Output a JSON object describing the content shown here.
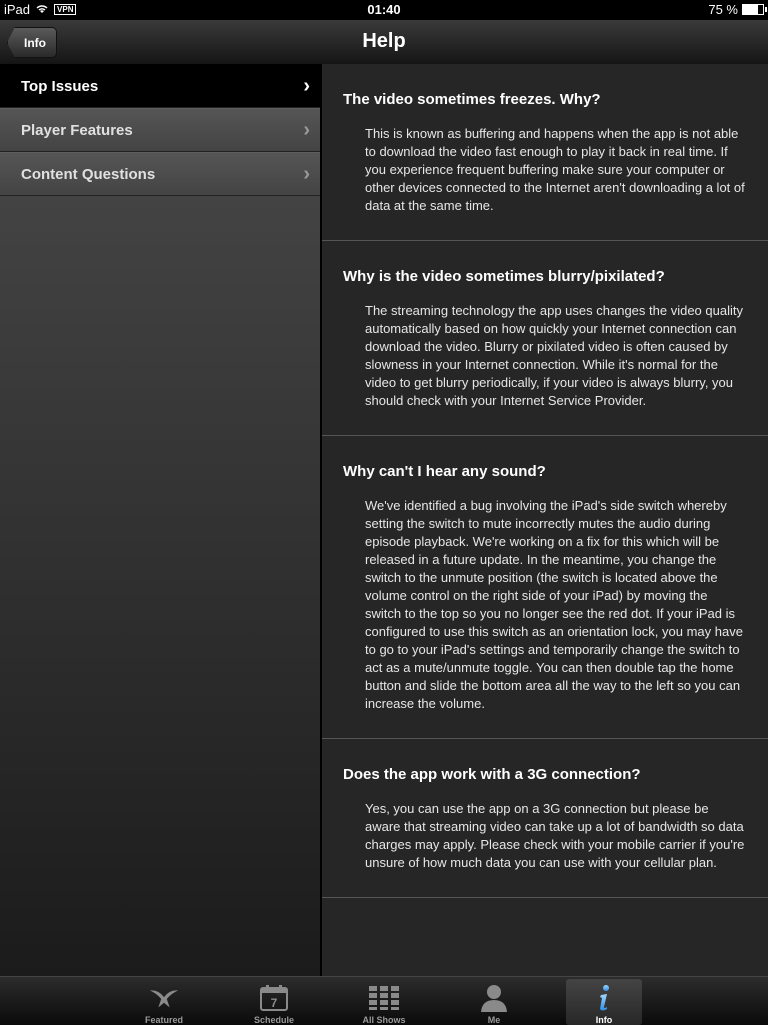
{
  "status_bar": {
    "carrier": "iPad",
    "vpn": "VPN",
    "time": "01:40",
    "battery": "75 %",
    "battery_level": 0.75
  },
  "nav": {
    "back_label": "Info",
    "title": "Help"
  },
  "sidebar": {
    "items": [
      {
        "label": "Top Issues",
        "selected": true
      },
      {
        "label": "Player Features"
      },
      {
        "label": "Content Questions"
      }
    ]
  },
  "faq": [
    {
      "question": "The video sometimes freezes. Why?",
      "answer": "This is known as buffering and happens when the app is not able to download the video fast enough to play it back in real time. If you experience frequent buffering make sure your computer or other devices connected to the Internet aren't downloading a lot of data at the same time."
    },
    {
      "question": "Why is the video sometimes blurry/pixilated?",
      "answer": "The streaming technology the app uses changes the video quality automatically based on how quickly your Internet connection can download the video. Blurry or pixilated video is often caused by slowness in your Internet connection. While it's normal for the video to get blurry periodically, if your video is always blurry, you should check with your Internet Service Provider."
    },
    {
      "question": "Why can't I hear any sound?",
      "answer": "We've identified a bug involving the iPad's side switch whereby setting the switch to mute incorrectly mutes the audio during episode playback. We're working on a fix for this which will be released in a future update. In the meantime, you change the switch to the unmute position (the switch is located above the volume control on the right side of your iPad) by moving the switch to the top so you no longer see the red dot. If your iPad is configured to use this switch as an orientation lock, you may have to go to your iPad's settings and temporarily change the switch to act as a mute/unmute toggle. You can then double tap the home button and slide the bottom area all the way to the left so you can increase the volume."
    },
    {
      "question": "Does the app work with a 3G connection?",
      "answer": "Yes, you can use the app on a 3G connection but please be aware that streaming video can take up a lot of bandwidth so data charges may apply. Please check with your mobile carrier if you're unsure of how much data you can use with your cellular plan."
    }
  ],
  "tabbar": {
    "tabs": [
      {
        "label": "Featured",
        "icon": "featured-icon"
      },
      {
        "label": "Schedule",
        "icon": "calendar-icon",
        "calendar_day": "7"
      },
      {
        "label": "All Shows",
        "icon": "grid-icon"
      },
      {
        "label": "Me",
        "icon": "person-icon"
      },
      {
        "label": "Info",
        "icon": "info-icon",
        "selected": true
      }
    ]
  }
}
